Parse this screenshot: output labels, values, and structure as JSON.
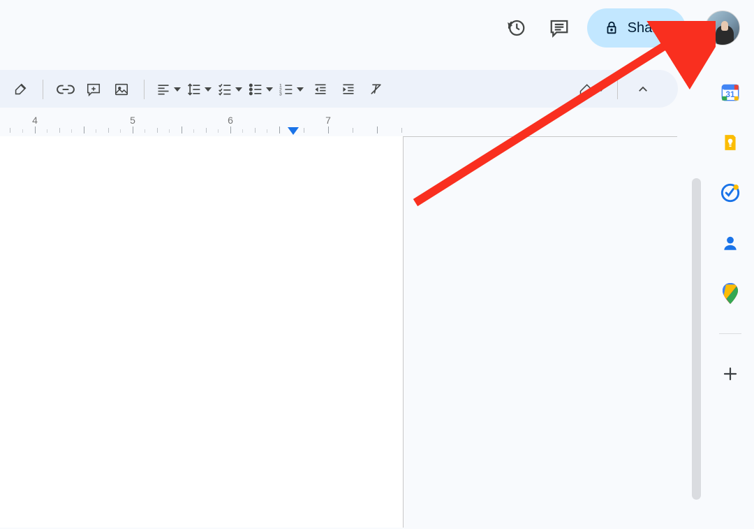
{
  "header": {
    "share_label": "Share"
  },
  "ruler": {
    "labels": [
      "4",
      "5",
      "6",
      "7"
    ],
    "right_indent_pos": 6.28
  },
  "side_panel": {
    "calendar_day": "31"
  },
  "colors": {
    "share_bg": "#c2e7ff",
    "arrow": "#f92f1f"
  }
}
